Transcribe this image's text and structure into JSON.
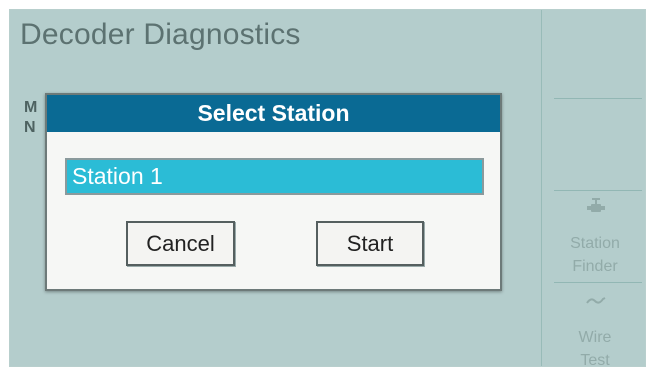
{
  "screen": {
    "title": "Decoder Diagnostics",
    "partial_line_1": "M",
    "partial_line_2": "N"
  },
  "sidebar": {
    "station_finder_label_line1": "Station",
    "station_finder_label_line2": "Finder",
    "wire_test_label_line1": "Wire",
    "wire_test_label_line2": "Test"
  },
  "dialog": {
    "title": "Select Station",
    "station_value": "Station 1",
    "cancel_label": "Cancel",
    "start_label": "Start"
  },
  "colors": {
    "header": "#0a6a94",
    "selection": "#2bbcd6",
    "screen_bg": "#c9dfdd"
  },
  "icons": {
    "station_finder": "valve-icon",
    "wire_test": "wave-icon"
  }
}
